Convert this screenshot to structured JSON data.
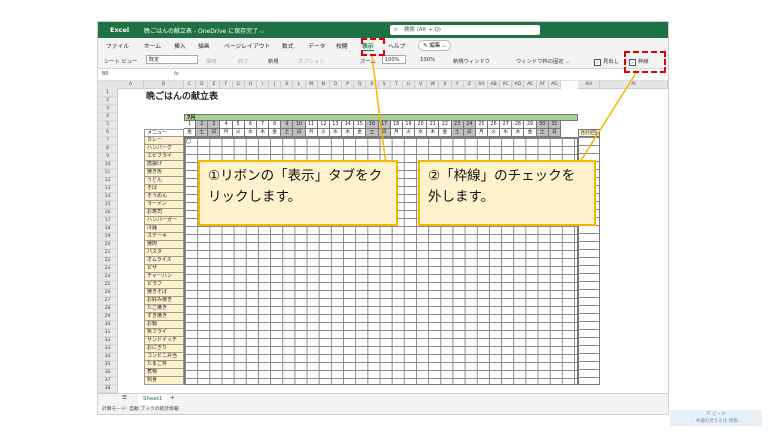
{
  "titlebar": {
    "app": "Excel",
    "doc": "晩ごはんの献立表 - OneDrive に保存完了 ⌵",
    "search": "検索 (Alt + Q)"
  },
  "tabs": [
    "ファイル",
    "ホーム",
    "挿入",
    "描画",
    "ページレイアウト",
    "数式",
    "データ",
    "校閲",
    "表示",
    "ヘルプ"
  ],
  "active_tab": "表示",
  "edit_button": "✎ 編集 ⌵",
  "ribbon": {
    "sheet_view_label": "シート ビュー",
    "sheet_view_value": "既定",
    "keep": "保持",
    "exit": "終了",
    "new": "新規",
    "options": "オプション",
    "zoom": "ズーム",
    "zoom_value": "100%",
    "zoom_100": "100%",
    "new_window": "新規ウィンドウ",
    "freeze": "ウィンドウ枠の固定 ⌵",
    "headings": "見出し",
    "gridlines": "枠線"
  },
  "formula_bar": {
    "name_box": "B6",
    "fx": "fx"
  },
  "columns": [
    "A",
    "B",
    "C",
    "D",
    "E",
    "F",
    "G",
    "H",
    "I",
    "J",
    "K",
    "L",
    "M",
    "N",
    "O",
    "P",
    "Q",
    "R",
    "S",
    "T",
    "U",
    "V",
    "W",
    "X",
    "Y",
    "Z",
    "AA",
    "AB",
    "AC",
    "AD",
    "AE",
    "AF",
    "AG",
    "AH",
    "AI"
  ],
  "rows": [
    "1",
    "2",
    "3",
    "4",
    "5",
    "6",
    "7",
    "8",
    "9",
    "10",
    "11",
    "12",
    "13",
    "14",
    "15",
    "16",
    "17",
    "18",
    "19",
    "20",
    "21",
    "22",
    "23",
    "24",
    "25",
    "26",
    "27",
    "28",
    "29",
    "30",
    "31",
    "32",
    "33",
    "34",
    "35",
    "36",
    "37",
    "38"
  ],
  "sheet": {
    "title": "晩ごはんの献立表",
    "month": "7月",
    "days": [
      "1",
      "2",
      "3",
      "4",
      "5",
      "6",
      "7",
      "8",
      "9",
      "10",
      "11",
      "12",
      "13",
      "14",
      "15",
      "16",
      "17",
      "18",
      "19",
      "20",
      "21",
      "22",
      "23",
      "24",
      "25",
      "26",
      "27",
      "28",
      "29",
      "30",
      "31"
    ],
    "weekdays": [
      "金",
      "土",
      "日",
      "月",
      "火",
      "水",
      "木",
      "金",
      "土",
      "日",
      "月",
      "火",
      "水",
      "木",
      "金",
      "土",
      "日",
      "月",
      "火",
      "水",
      "木",
      "金",
      "土",
      "日",
      "月",
      "火",
      "水",
      "木",
      "金",
      "土",
      "日"
    ],
    "total_header": "合計(回)",
    "menu_header": "メニュー",
    "menu_items": [
      "カレー",
      "ハンバーグ",
      "エビフライ",
      "唐揚げ",
      "焼き魚",
      "うどん",
      "そば",
      "そうめん",
      "ラーメン",
      "お寿司",
      "ハンバーガー",
      "冷麺",
      "ステーキ",
      "焼肉",
      "パスタ",
      "オムライス",
      "ピザ",
      "チャーハン",
      "ピラフ",
      "焼きそば",
      "お好み焼き",
      "たこ焼き",
      "すき焼き",
      "お鍋",
      "魚フライ",
      "サンドイッチ",
      "おにぎり",
      "コンビニ弁当",
      "たまご丼",
      "煮物",
      "刺身"
    ],
    "first_mark": "〇"
  },
  "callouts": {
    "one": "①リボンの「表示」タブをクリックします。",
    "two": "②「枠線」のチェックを外します。"
  },
  "sheet_tab": "Sheet1",
  "sheet_add": "+",
  "sheet_menu": "☰",
  "status": "計算モード: 自動    ブックの統計情報",
  "corner_logo": "IT ピーク\n… 共通の見える化 情報…",
  "colors": {
    "excel_green": "#1e7145",
    "callout_border": "#f5b700",
    "highlight": "#e00000"
  }
}
